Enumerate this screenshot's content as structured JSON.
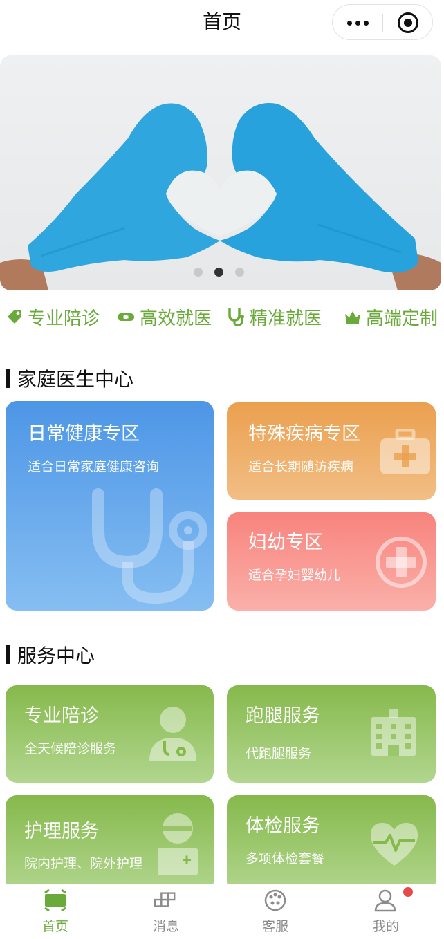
{
  "nav": {
    "title": "首页"
  },
  "banner": {
    "slide_count": 3,
    "active_slide": 2
  },
  "features": [
    {
      "label": "专业陪诊",
      "icon": "tag-icon"
    },
    {
      "label": "高效就医",
      "icon": "pill-icon"
    },
    {
      "label": "精准就医",
      "icon": "stethoscope-icon"
    },
    {
      "label": "高端定制",
      "icon": "crown-icon"
    }
  ],
  "family": {
    "title": "家庭医生中心",
    "daily": {
      "title": "日常健康专区",
      "subtitle": "适合日常家庭健康咨询"
    },
    "special": {
      "title": "特殊疾病专区",
      "subtitle": "适合长期随访疾病"
    },
    "maternal": {
      "title": "妇幼专区",
      "subtitle": "适合孕妇婴幼儿"
    }
  },
  "services": {
    "title": "服务中心",
    "escort": {
      "title": "专业陪诊",
      "subtitle": "全天候陪诊服务"
    },
    "errand": {
      "title": "跑腿服务",
      "subtitle": "代跑腿服务"
    },
    "nursing": {
      "title": "护理服务",
      "subtitle": "院内护理、院外护理"
    },
    "checkup": {
      "title": "体检服务",
      "subtitle": "多项体检套餐"
    }
  },
  "tabbar": {
    "home": "首页",
    "messages": "消息",
    "support": "客服",
    "mine": "我的"
  },
  "colors": {
    "accent_green": "#6aaa3a",
    "card_blue": "#4d96e6",
    "card_orange": "#eba04f",
    "card_red": "#f8837d",
    "card_green": "#86b94c",
    "badge_red": "#e94848"
  }
}
